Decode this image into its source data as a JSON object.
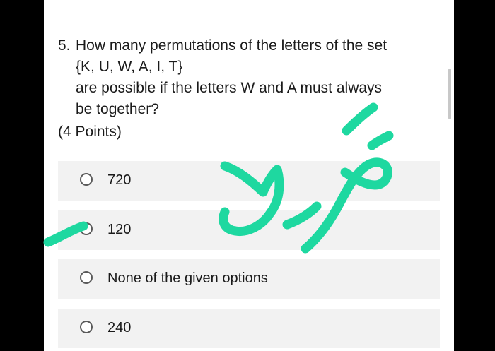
{
  "question": {
    "number": "5.",
    "lines": [
      "How many permutations of the letters of the set",
      "{K, U, W, A, I, T}",
      "are possible if the letters W and A must always",
      "be together?"
    ],
    "points": "(4 Points)"
  },
  "options": [
    {
      "label": "720",
      "selected": false
    },
    {
      "label": "120",
      "selected": false
    },
    {
      "label": "None of the given options",
      "selected": false
    },
    {
      "label": "240",
      "selected": false
    }
  ],
  "colors": {
    "ink_annotation": "#1ed8a0",
    "option_background": "#f2f2f2",
    "text": "#1a1a1a"
  }
}
